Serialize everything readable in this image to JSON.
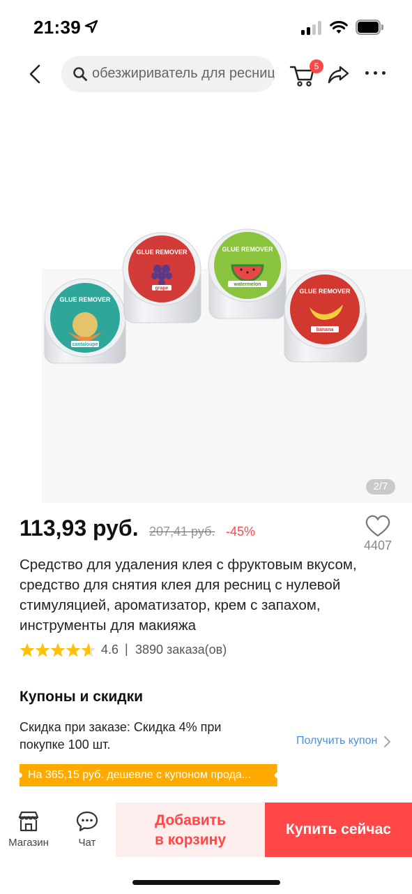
{
  "status_bar": {
    "time": "21:39",
    "icons": [
      "location-arrow-icon",
      "cellular-signal-icon",
      "wifi-icon",
      "battery-icon"
    ]
  },
  "header": {
    "search_text": "обезжириватель для ресниц",
    "cart_badge": "5",
    "icons": [
      "back-chevron-icon",
      "search-icon",
      "cart-icon",
      "share-icon",
      "more-dots-icon"
    ]
  },
  "gallery": {
    "counter": "2/7",
    "jars": [
      {
        "brand": "GLUE REMOVER",
        "flavor": "cantaloupe",
        "color": "#2ea79a"
      },
      {
        "brand": "GLUE REMOVER",
        "flavor": "grape",
        "color": "#d23b37"
      },
      {
        "brand": "GLUE REMOVER",
        "flavor": "watermelon",
        "color": "#8ac43f"
      },
      {
        "brand": "GLUE REMOVER",
        "flavor": "banana",
        "color": "#d2382f"
      }
    ]
  },
  "product": {
    "price": "113,93 руб.",
    "old_price": "207,41 руб.",
    "discount": "-45%",
    "wishlist_count": "4407",
    "title": "Средство для удаления клея с фруктовым вкусом, средство для снятия клея для ресниц с нулевой стимуляцией, ароматизатор, крем с запахом, инструменты для макияжа",
    "rating": "4.6",
    "rating_fraction": 0.92,
    "rating_separator": "|",
    "orders": "3890 заказа(ов)"
  },
  "coupons": {
    "title": "Купоны и скидки",
    "description": "Скидка при заказе: Скидка 4% при покупке 100 шт.",
    "get_coupon": "Получить купон",
    "banner": "На 365,15 руб. дешевле с купоном прода..."
  },
  "bottom_bar": {
    "store_label": "Магазин",
    "chat_label": "Чат",
    "add_to_cart_line1": "Добавить",
    "add_to_cart_line2": "в корзину",
    "buy_now": "Купить сейчас"
  },
  "colors": {
    "accent": "#ff4747",
    "coupon_banner": "#ffaa00",
    "link": "#4a90d9",
    "star": "#ffc107"
  }
}
